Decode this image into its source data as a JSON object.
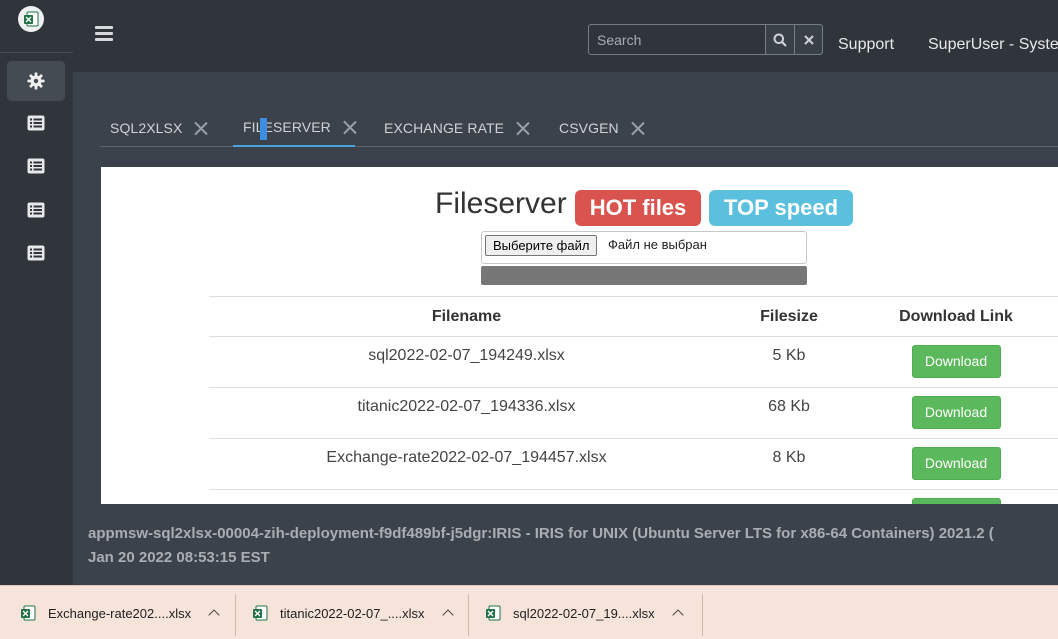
{
  "topbar": {
    "search_placeholder": "Search",
    "support_label": "Support",
    "user_label": "SuperUser - System"
  },
  "tabs": [
    {
      "label": "SQL2XLSX"
    },
    {
      "label": "FILESERVER"
    },
    {
      "label": "EXCHANGE RATE"
    },
    {
      "label": "CSVGEN"
    }
  ],
  "page": {
    "title": "Fileserver",
    "badge_hot": "HOT files",
    "badge_top": "TOP speed",
    "choose_file_label": "Выберите файл",
    "no_file_text": "Файл не выбран"
  },
  "table": {
    "headers": [
      "Filename",
      "Filesize",
      "Download Link"
    ],
    "rows": [
      {
        "filename": "sql2022-02-07_194249.xlsx",
        "size": "5 Kb",
        "link": "Download"
      },
      {
        "filename": "titanic2022-02-07_194336.xlsx",
        "size": "68 Kb",
        "link": "Download"
      },
      {
        "filename": "Exchange-rate2022-02-07_194457.xlsx",
        "size": "8 Kb",
        "link": "Download"
      }
    ]
  },
  "footer": {
    "line1": "appmsw-sql2xlsx-00004-zih-deployment-f9df489bf-j5dgr:IRIS - IRIS for UNIX (Ubuntu Server LTS for x86-64 Containers) 2021.2 (",
    "line2": "Jan 20 2022 08:53:15 EST"
  },
  "downloads": [
    {
      "name": "Exchange-rate202....xlsx"
    },
    {
      "name": "titanic2022-02-07_....xlsx"
    },
    {
      "name": "sql2022-02-07_19....xlsx"
    }
  ],
  "colors": {
    "sidebar": "#30353c",
    "background": "#3c424b",
    "hot": "#d9534f",
    "top": "#5bc0de",
    "download_button": "#5cb85c",
    "download_bar": "#f6e3d9"
  }
}
